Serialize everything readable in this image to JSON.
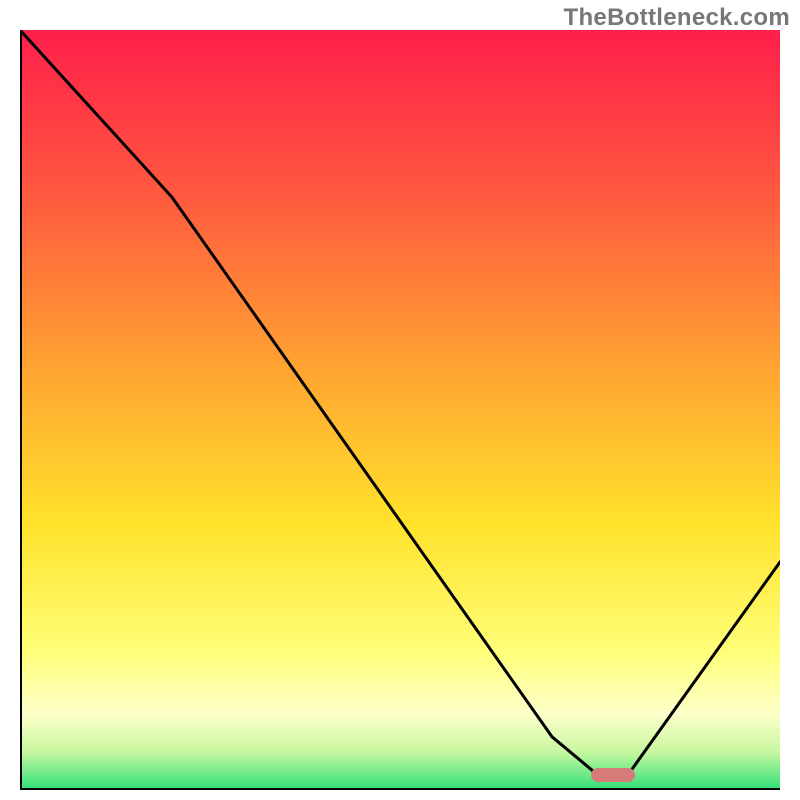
{
  "watermark": "TheBottleneck.com",
  "chart_data": {
    "type": "line",
    "title": "",
    "xlabel": "",
    "ylabel": "",
    "xlim": [
      0,
      100
    ],
    "ylim": [
      0,
      100
    ],
    "grid": false,
    "legend": false,
    "series": [
      {
        "name": "bottleneck-curve",
        "x": [
          0,
          20,
          70,
          76,
          80,
          100
        ],
        "y": [
          100,
          78,
          7,
          2,
          2,
          30
        ]
      }
    ],
    "annotations": [
      {
        "name": "optimal-marker",
        "x": 78,
        "y": 2,
        "width_pct": 5.8,
        "color": "#d77a7a"
      }
    ],
    "gradient_stops": [
      {
        "offset": 0.0,
        "color": "#ff1f4b"
      },
      {
        "offset": 0.2,
        "color": "#ff5440"
      },
      {
        "offset": 0.45,
        "color": "#ffa531"
      },
      {
        "offset": 0.65,
        "color": "#ffe22b"
      },
      {
        "offset": 0.82,
        "color": "#ffff7a"
      },
      {
        "offset": 0.9,
        "color": "#fdffc9"
      },
      {
        "offset": 0.95,
        "color": "#c7f7a0"
      },
      {
        "offset": 1.0,
        "color": "#2fe07a"
      }
    ],
    "axis_color": "#000000"
  }
}
